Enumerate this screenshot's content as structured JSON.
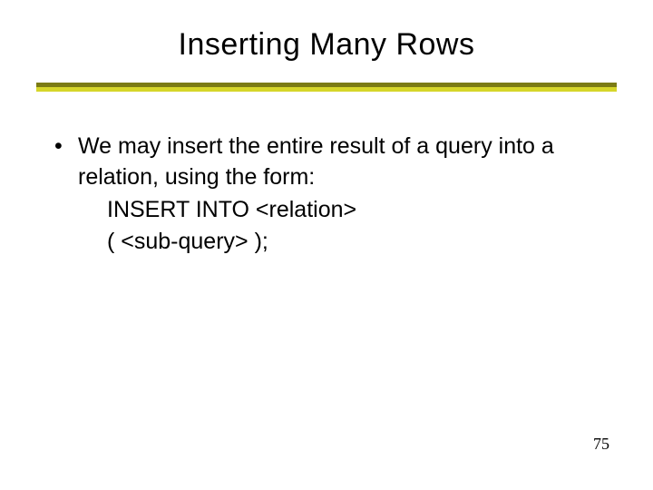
{
  "slide": {
    "title": "Inserting Many Rows",
    "bullet_marker": "•",
    "bullet_text": "We may insert the entire result of a query into a relation, using the form:",
    "code_line_1": "INSERT INTO <relation>",
    "code_line_2": "( <sub-query> );",
    "page_number": "75"
  }
}
